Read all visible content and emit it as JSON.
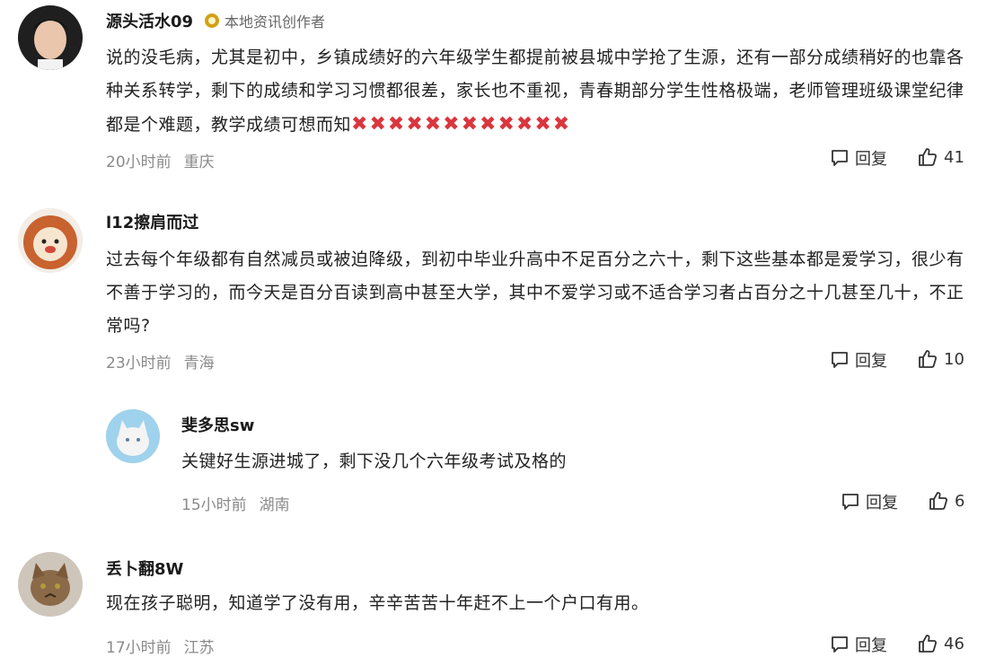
{
  "comments": [
    {
      "username": "源头活水09",
      "badge": "本地资讯创作者",
      "text": "说的没毛病，尤其是初中，乡镇成绩好的六年级学生都提前被县城中学抢了生源，还有一部分成绩稍好的也靠各种关系转学，剩下的成绩和学习习惯都很差，家长也不重视，青春期部分学生性格极端，老师管理班级课堂纪律都是个难题，教学成绩可想而知",
      "x_marks": "✖✖✖✖✖✖✖✖✖✖✖✖",
      "time": "20小时前",
      "location": "重庆",
      "reply_label": "回复",
      "likes": "41"
    },
    {
      "username": "l12擦肩而过",
      "text": "过去每个年级都有自然减员或被迫降级，到初中毕业升高中不足百分之六十，剩下这些基本都是爱学习，很少有不善于学习的，而今天是百分百读到高中甚至大学，其中不爱学习或不适合学习者占百分之十几甚至几十，不正常吗?",
      "time": "23小时前",
      "location": "青海",
      "reply_label": "回复",
      "likes": "10"
    },
    {
      "username": "斐多思sw",
      "text": "关键好生源进城了，剩下没几个六年级考试及格的",
      "time": "15小时前",
      "location": "湖南",
      "reply_label": "回复",
      "likes": "6"
    },
    {
      "username": "丢卜翻8W",
      "text": "现在孩子聪明，知道学了没有用，辛辛苦苦十年赶不上一个户口有用。",
      "time": "17小时前",
      "location": "江苏",
      "reply_label": "回复",
      "likes": "46"
    }
  ]
}
